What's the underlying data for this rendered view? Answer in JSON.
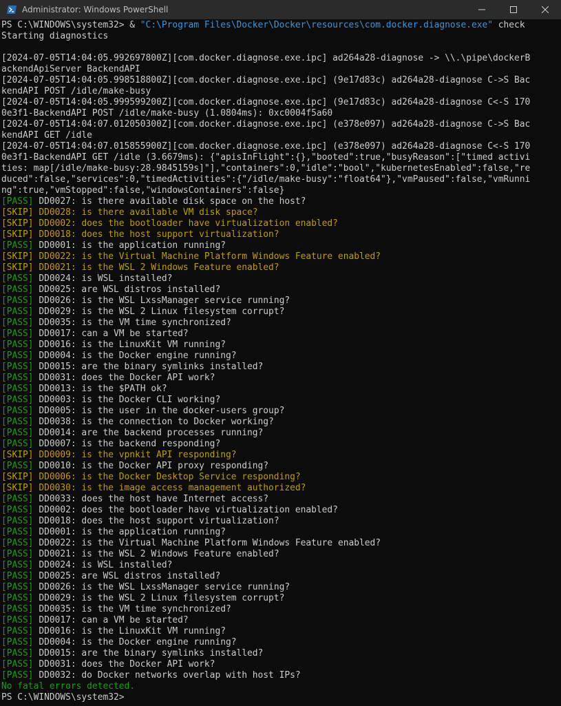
{
  "window": {
    "title": "Administrator: Windows PowerShell",
    "controls": {
      "minimize": "minimize-icon",
      "maximize": "maximize-icon",
      "close": "close-icon"
    }
  },
  "colors": {
    "background": "#0c0c0c",
    "text": "#cccccc",
    "command": "#f9f1a5",
    "string": "#3a96dd",
    "pass": "#13a10e",
    "skip": "#c19c00"
  },
  "terminal": {
    "lines": [
      [
        {
          "t": "PS C:\\WINDOWS\\system32> ",
          "c": "default"
        },
        {
          "t": "& ",
          "c": "default"
        },
        {
          "t": "\"C:\\Program Files\\Docker\\Docker\\resources\\com.docker.diagnose.exe\"",
          "c": "str"
        },
        {
          "t": " check",
          "c": "default"
        }
      ],
      [
        {
          "t": "Starting diagnostics",
          "c": "default"
        }
      ],
      [
        {
          "t": "",
          "c": "default"
        }
      ],
      [
        {
          "t": "[2024-07-05T14:04:05.992697800Z][com.docker.diagnose.exe.ipc] ad264a28-diagnose -> \\\\.\\pipe\\dockerB",
          "c": "default"
        }
      ],
      [
        {
          "t": "ackendApiServer BackendAPI",
          "c": "default"
        }
      ],
      [
        {
          "t": "[2024-07-05T14:04:05.998518800Z][com.docker.diagnose.exe.ipc] (9e17d83c) ad264a28-diagnose C->S Bac",
          "c": "default"
        }
      ],
      [
        {
          "t": "kendAPI POST /idle/make-busy",
          "c": "default"
        }
      ],
      [
        {
          "t": "[2024-07-05T14:04:05.999599200Z][com.docker.diagnose.exe.ipc] (9e17d83c) ad264a28-diagnose C<-S 170",
          "c": "default"
        }
      ],
      [
        {
          "t": "0e3f1-BackendAPI POST /idle/make-busy (1.0804ms): 0xc0004f5a60",
          "c": "default"
        }
      ],
      [
        {
          "t": "[2024-07-05T14:04:07.012050300Z][com.docker.diagnose.exe.ipc] (e378e097) ad264a28-diagnose C->S Bac",
          "c": "default"
        }
      ],
      [
        {
          "t": "kendAPI GET /idle",
          "c": "default"
        }
      ],
      [
        {
          "t": "[2024-07-05T14:04:07.015855900Z][com.docker.diagnose.exe.ipc] (e378e097) ad264a28-diagnose C<-S 170",
          "c": "default"
        }
      ],
      [
        {
          "t": "0e3f1-BackendAPI GET /idle (3.6679ms): {\"apisInFlight\":{},\"booted\":true,\"busyReason\":[\"timed activi",
          "c": "default"
        }
      ],
      [
        {
          "t": "ties: map[/idle/make-busy:28.9845159s]\"],\"containers\":0,\"idle\":\"bool\",\"kubernetesEnabled\":false,\"re",
          "c": "default"
        }
      ],
      [
        {
          "t": "duced\":false,\"services\":0,\"timedActivities\":{\"/idle/make-busy\":\"float64\"},\"vmPaused\":false,\"vmRunni",
          "c": "default"
        }
      ],
      [
        {
          "t": "ng\":true,\"vmStopped\":false,\"windowsContainers\":false}",
          "c": "default"
        }
      ],
      [
        {
          "t": "[PASS]",
          "c": "pass"
        },
        {
          "t": " DD0027: is there available disk space on the host?",
          "c": "default"
        }
      ],
      [
        {
          "t": "[SKIP] DD0028: is there available VM disk space?",
          "c": "skip"
        }
      ],
      [
        {
          "t": "[SKIP] DD0002: does the bootloader have virtualization enabled?",
          "c": "skip"
        }
      ],
      [
        {
          "t": "[SKIP] DD0018: does the host support virtualization?",
          "c": "skip"
        }
      ],
      [
        {
          "t": "[PASS]",
          "c": "pass"
        },
        {
          "t": " DD0001: is the application running?",
          "c": "default"
        }
      ],
      [
        {
          "t": "[SKIP] DD0022: is the Virtual Machine Platform Windows Feature enabled?",
          "c": "skip"
        }
      ],
      [
        {
          "t": "[SKIP] DD0021: is the WSL 2 Windows Feature enabled?",
          "c": "skip"
        }
      ],
      [
        {
          "t": "[PASS]",
          "c": "pass"
        },
        {
          "t": " DD0024: is WSL installed?",
          "c": "default"
        }
      ],
      [
        {
          "t": "[PASS]",
          "c": "pass"
        },
        {
          "t": " DD0025: are WSL distros installed?",
          "c": "default"
        }
      ],
      [
        {
          "t": "[PASS]",
          "c": "pass"
        },
        {
          "t": " DD0026: is the WSL LxssManager service running?",
          "c": "default"
        }
      ],
      [
        {
          "t": "[PASS]",
          "c": "pass"
        },
        {
          "t": " DD0029: is the WSL 2 Linux filesystem corrupt?",
          "c": "default"
        }
      ],
      [
        {
          "t": "[PASS]",
          "c": "pass"
        },
        {
          "t": " DD0035: is the VM time synchronized?",
          "c": "default"
        }
      ],
      [
        {
          "t": "[PASS]",
          "c": "pass"
        },
        {
          "t": " DD0017: can a VM be started?",
          "c": "default"
        }
      ],
      [
        {
          "t": "[PASS]",
          "c": "pass"
        },
        {
          "t": " DD0016: is the LinuxKit VM running?",
          "c": "default"
        }
      ],
      [
        {
          "t": "[PASS]",
          "c": "pass"
        },
        {
          "t": " DD0004: is the Docker engine running?",
          "c": "default"
        }
      ],
      [
        {
          "t": "[PASS]",
          "c": "pass"
        },
        {
          "t": " DD0015: are the binary symlinks installed?",
          "c": "default"
        }
      ],
      [
        {
          "t": "[PASS]",
          "c": "pass"
        },
        {
          "t": " DD0031: does the Docker API work?",
          "c": "default"
        }
      ],
      [
        {
          "t": "[PASS]",
          "c": "pass"
        },
        {
          "t": " DD0013: is the $PATH ok?",
          "c": "default"
        }
      ],
      [
        {
          "t": "[PASS]",
          "c": "pass"
        },
        {
          "t": " DD0003: is the Docker CLI working?",
          "c": "default"
        }
      ],
      [
        {
          "t": "[PASS]",
          "c": "pass"
        },
        {
          "t": " DD0005: is the user in the docker-users group?",
          "c": "default"
        }
      ],
      [
        {
          "t": "[PASS]",
          "c": "pass"
        },
        {
          "t": " DD0038: is the connection to Docker working?",
          "c": "default"
        }
      ],
      [
        {
          "t": "[PASS]",
          "c": "pass"
        },
        {
          "t": " DD0014: are the backend processes running?",
          "c": "default"
        }
      ],
      [
        {
          "t": "[PASS]",
          "c": "pass"
        },
        {
          "t": " DD0007: is the backend responding?",
          "c": "default"
        }
      ],
      [
        {
          "t": "[SKIP] DD0009: is the vpnkit API responding?",
          "c": "skip"
        }
      ],
      [
        {
          "t": "[PASS]",
          "c": "pass"
        },
        {
          "t": " DD0010: is the Docker API proxy responding?",
          "c": "default"
        }
      ],
      [
        {
          "t": "[SKIP] DD0006: is the Docker Desktop Service responding?",
          "c": "skip"
        }
      ],
      [
        {
          "t": "[SKIP] DD0030: is the image access management authorized?",
          "c": "skip"
        }
      ],
      [
        {
          "t": "[PASS]",
          "c": "pass"
        },
        {
          "t": " DD0033: does the host have Internet access?",
          "c": "default"
        }
      ],
      [
        {
          "t": "[PASS]",
          "c": "pass"
        },
        {
          "t": " DD0002: does the bootloader have virtualization enabled?",
          "c": "default"
        }
      ],
      [
        {
          "t": "[PASS]",
          "c": "pass"
        },
        {
          "t": " DD0018: does the host support virtualization?",
          "c": "default"
        }
      ],
      [
        {
          "t": "[PASS]",
          "c": "pass"
        },
        {
          "t": " DD0001: is the application running?",
          "c": "default"
        }
      ],
      [
        {
          "t": "[PASS]",
          "c": "pass"
        },
        {
          "t": " DD0022: is the Virtual Machine Platform Windows Feature enabled?",
          "c": "default"
        }
      ],
      [
        {
          "t": "[PASS]",
          "c": "pass"
        },
        {
          "t": " DD0021: is the WSL 2 Windows Feature enabled?",
          "c": "default"
        }
      ],
      [
        {
          "t": "[PASS]",
          "c": "pass"
        },
        {
          "t": " DD0024: is WSL installed?",
          "c": "default"
        }
      ],
      [
        {
          "t": "[PASS]",
          "c": "pass"
        },
        {
          "t": " DD0025: are WSL distros installed?",
          "c": "default"
        }
      ],
      [
        {
          "t": "[PASS]",
          "c": "pass"
        },
        {
          "t": " DD0026: is the WSL LxssManager service running?",
          "c": "default"
        }
      ],
      [
        {
          "t": "[PASS]",
          "c": "pass"
        },
        {
          "t": " DD0029: is the WSL 2 Linux filesystem corrupt?",
          "c": "default"
        }
      ],
      [
        {
          "t": "[PASS]",
          "c": "pass"
        },
        {
          "t": " DD0035: is the VM time synchronized?",
          "c": "default"
        }
      ],
      [
        {
          "t": "[PASS]",
          "c": "pass"
        },
        {
          "t": " DD0017: can a VM be started?",
          "c": "default"
        }
      ],
      [
        {
          "t": "[PASS]",
          "c": "pass"
        },
        {
          "t": " DD0016: is the LinuxKit VM running?",
          "c": "default"
        }
      ],
      [
        {
          "t": "[PASS]",
          "c": "pass"
        },
        {
          "t": " DD0004: is the Docker engine running?",
          "c": "default"
        }
      ],
      [
        {
          "t": "[PASS]",
          "c": "pass"
        },
        {
          "t": " DD0015: are the binary symlinks installed?",
          "c": "default"
        }
      ],
      [
        {
          "t": "[PASS]",
          "c": "pass"
        },
        {
          "t": " DD0031: does the Docker API work?",
          "c": "default"
        }
      ],
      [
        {
          "t": "[PASS]",
          "c": "pass"
        },
        {
          "t": " DD0032: do Docker networks overlap with host IPs?",
          "c": "default"
        }
      ],
      [
        {
          "t": "No fatal errors detected.",
          "c": "ok"
        }
      ],
      [
        {
          "t": "PS C:\\WINDOWS\\system32> ",
          "c": "default"
        }
      ]
    ]
  }
}
